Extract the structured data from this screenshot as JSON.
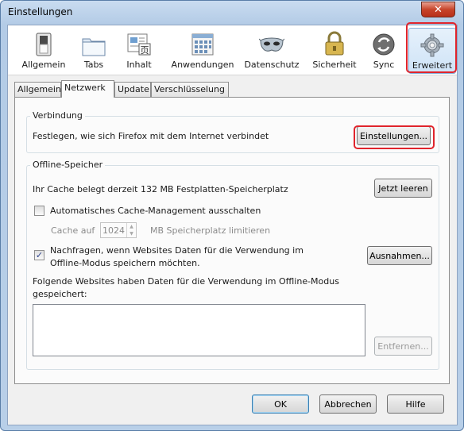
{
  "window": {
    "title": "Einstellungen",
    "close_glyph": "✕"
  },
  "toolbar": {
    "items": [
      {
        "label": "Allgemein",
        "icon": "switch-icon"
      },
      {
        "label": "Tabs",
        "icon": "tabs-icon"
      },
      {
        "label": "Inhalt",
        "icon": "content-icon"
      },
      {
        "label": "Anwendungen",
        "icon": "applications-icon"
      },
      {
        "label": "Datenschutz",
        "icon": "privacy-mask-icon"
      },
      {
        "label": "Sicherheit",
        "icon": "padlock-icon"
      },
      {
        "label": "Sync",
        "icon": "sync-icon"
      },
      {
        "label": "Erweitert",
        "icon": "gear-icon",
        "selected": true
      }
    ]
  },
  "tabs": [
    "Allgemein",
    "Netzwerk",
    "Update",
    "Verschlüsselung"
  ],
  "active_tab": "Netzwerk",
  "connection": {
    "legend": "Verbindung",
    "description": "Festlegen, wie sich Firefox mit dem Internet verbindet",
    "settings_button": "Einstellungen..."
  },
  "offline": {
    "legend": "Offline-Speicher",
    "cache_text": "Ihr Cache belegt derzeit 132 MB Festplatten-Speicherplatz",
    "clear_button": "Jetzt leeren",
    "auto_cache_label": "Automatisches Cache-Management ausschalten",
    "auto_cache_checked": false,
    "cache_prefix": "Cache auf",
    "cache_value": "1024",
    "cache_suffix": "MB Speicherplatz limitieren",
    "ask_label_line1": "Nachfragen, wenn Websites Daten für die Verwendung im",
    "ask_label_line2": "Offline-Modus speichern möchten.",
    "ask_checked": true,
    "check_glyph": "✓",
    "exceptions_button": "Ausnahmen...",
    "sites_text_line1": "Folgende Websites haben Daten für die Verwendung im Offline-Modus",
    "sites_text_line2": "gespeichert:",
    "sites": [],
    "remove_button": "Entfernen..."
  },
  "footer": {
    "ok": "OK",
    "cancel": "Abbrechen",
    "help": "Hilfe"
  },
  "colors": {
    "highlight": "#e0242c",
    "title_bar": "#b9d1ea",
    "close_button": "#c7442a"
  }
}
